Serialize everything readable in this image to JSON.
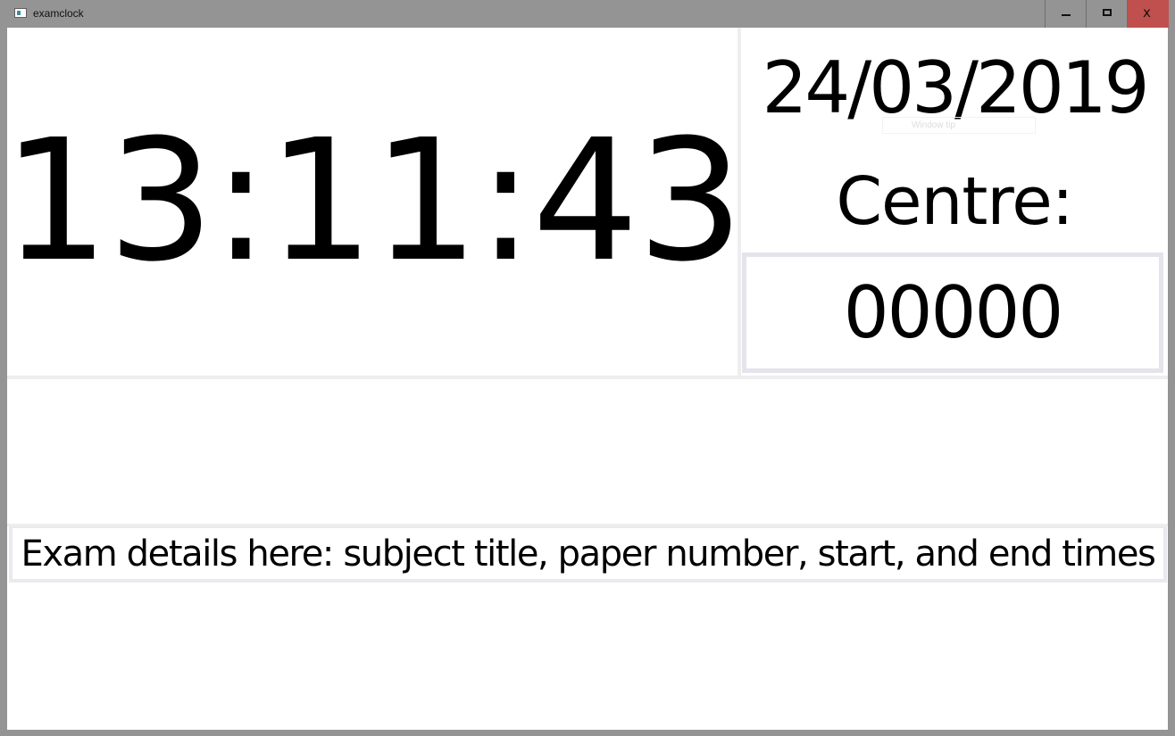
{
  "window": {
    "title": "examclock",
    "icon": "app-window-icon",
    "controls": {
      "minimize_icon": "minimize-icon",
      "maximize_icon": "maximize-icon",
      "close_icon": "close-icon",
      "close_glyph": "x"
    },
    "close_hover_color": "#c0504d"
  },
  "clock": {
    "time": "13:11:43"
  },
  "date": {
    "value": "24/03/2019"
  },
  "tooltip": {
    "text": "Window tip"
  },
  "centre": {
    "label": "Centre:",
    "value": "00000"
  },
  "exam": {
    "details": "Exam details here: subject title, paper number, start, and end times"
  }
}
